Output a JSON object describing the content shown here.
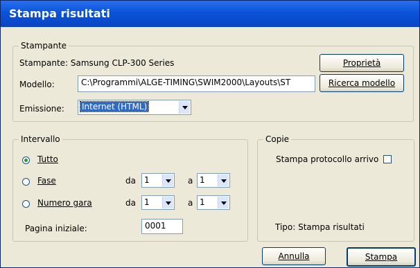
{
  "window": {
    "title": "Stampa risultati"
  },
  "printer_group": {
    "label": "Stampante",
    "printer_text": "Stampante: Samsung CLP-300 Series",
    "properties_button": "Proprietà",
    "model_label": "Modello:",
    "model_value": "C:\\Programmi\\ALGE-TIMING\\SWIM2000\\Layouts\\ST",
    "search_model_button": "Ricerca modello",
    "output_label": "Emissione:",
    "output_value": "Internet (HTML)"
  },
  "range_group": {
    "label": "Intervallo",
    "all_label": "Tutto",
    "phase_label": "Fase",
    "race_number_label": "Numero gara",
    "from_label": "da",
    "to_label": "a",
    "phase_from": "1",
    "phase_to": "1",
    "race_from": "1",
    "race_to": "1",
    "start_page_label": "Pagina iniziale:",
    "start_page_value": "0001",
    "selected": "Tutto"
  },
  "copies_group": {
    "label": "Copie",
    "print_arrival_label": "Stampa protocollo arrivo",
    "print_arrival_checked": false,
    "type_text": "Tipo: Stampa risultati"
  },
  "buttons": {
    "cancel": "Annulla",
    "print": "Stampa"
  },
  "colors": {
    "titlebar": "#0a53d8",
    "dialog_bg": "#ece9d8",
    "selection": "#316ac5"
  }
}
